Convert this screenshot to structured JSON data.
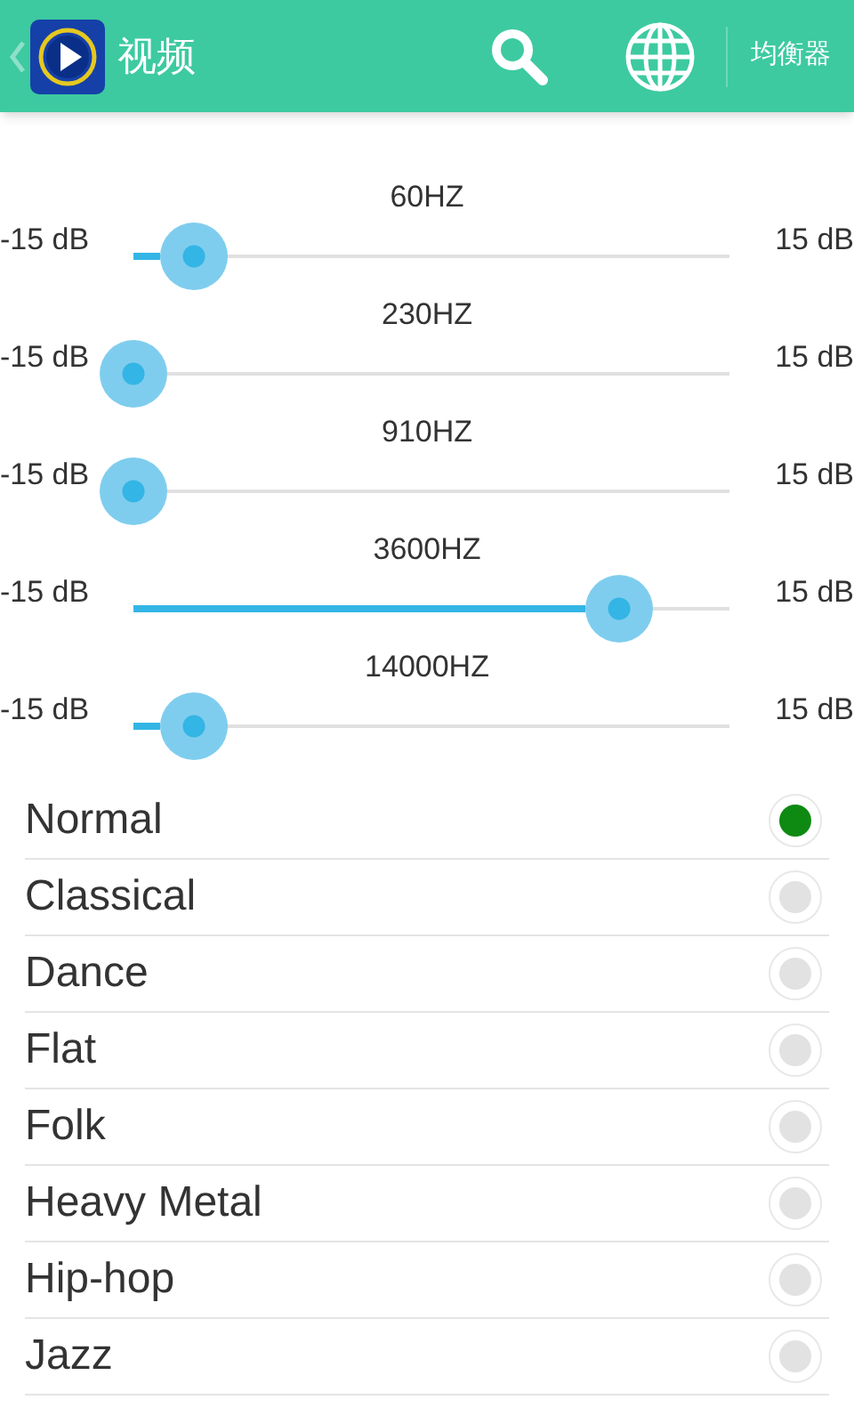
{
  "header": {
    "title": "视频",
    "action": "均衡器"
  },
  "bands": [
    {
      "label": "60HZ",
      "min": "-15 dB",
      "max": "15 dB",
      "level": 0.1
    },
    {
      "label": "230HZ",
      "min": "-15 dB",
      "max": "15 dB",
      "level": 0
    },
    {
      "label": "910HZ",
      "min": "-15 dB",
      "max": "15 dB",
      "level": 0
    },
    {
      "label": "3600HZ",
      "min": "-15 dB",
      "max": "15 dB",
      "level": 0.815
    },
    {
      "label": "14000HZ",
      "min": "-15 dB",
      "max": "15 dB",
      "level": 0.1
    }
  ],
  "presets": [
    {
      "name": "Normal",
      "selected": true
    },
    {
      "name": "Classical",
      "selected": false
    },
    {
      "name": "Dance",
      "selected": false
    },
    {
      "name": "Flat",
      "selected": false
    },
    {
      "name": "Folk",
      "selected": false
    },
    {
      "name": "Heavy Metal",
      "selected": false
    },
    {
      "name": "Hip-hop",
      "selected": false
    },
    {
      "name": "Jazz",
      "selected": false
    }
  ]
}
